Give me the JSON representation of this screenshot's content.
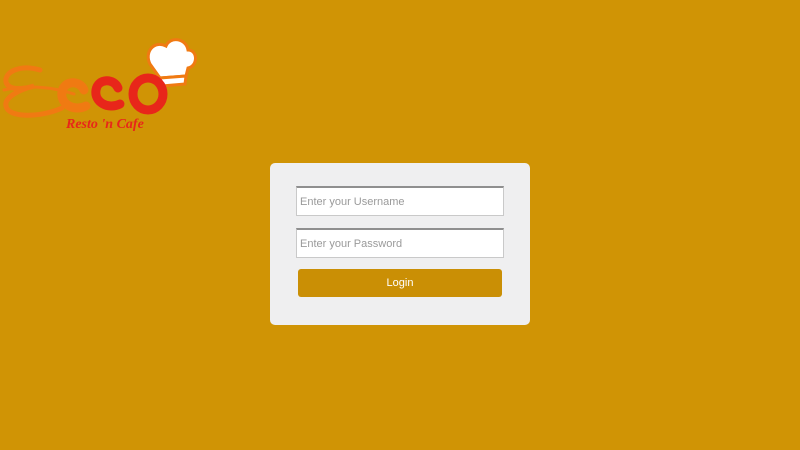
{
  "brand": {
    "logo_text": "ECCO",
    "tagline": "Resto 'n Cafe",
    "icon": "chef-hat-icon"
  },
  "login": {
    "username_placeholder": "Enter your Username",
    "username_value": "",
    "password_placeholder": "Enter your Password",
    "password_value": "",
    "button_label": "Login"
  },
  "colors": {
    "background": "#d09405",
    "card": "#efeff0",
    "button": "#ca8f05",
    "logo_red": "#e8261a",
    "logo_orange": "#f07a12"
  }
}
